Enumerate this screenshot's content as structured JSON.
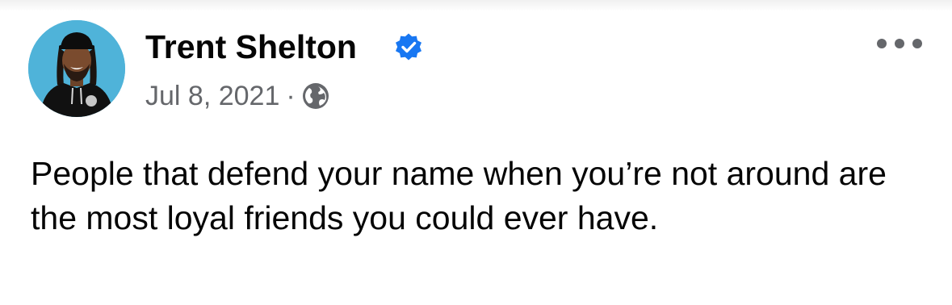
{
  "post": {
    "author": {
      "name": "Trent Shelton",
      "verified": true,
      "avatar_icon": "profile-photo"
    },
    "date": "Jul 8, 2021",
    "separator": "·",
    "audience_icon": "globe-icon",
    "more_icon": "more-options-icon",
    "text": "People that defend your name when you’re not around are the most loyal friends you could ever have."
  },
  "colors": {
    "verified_blue": "#1877f2",
    "secondary_text": "#65676b",
    "primary_text": "#050505",
    "avatar_background": "#4fb3d9"
  }
}
